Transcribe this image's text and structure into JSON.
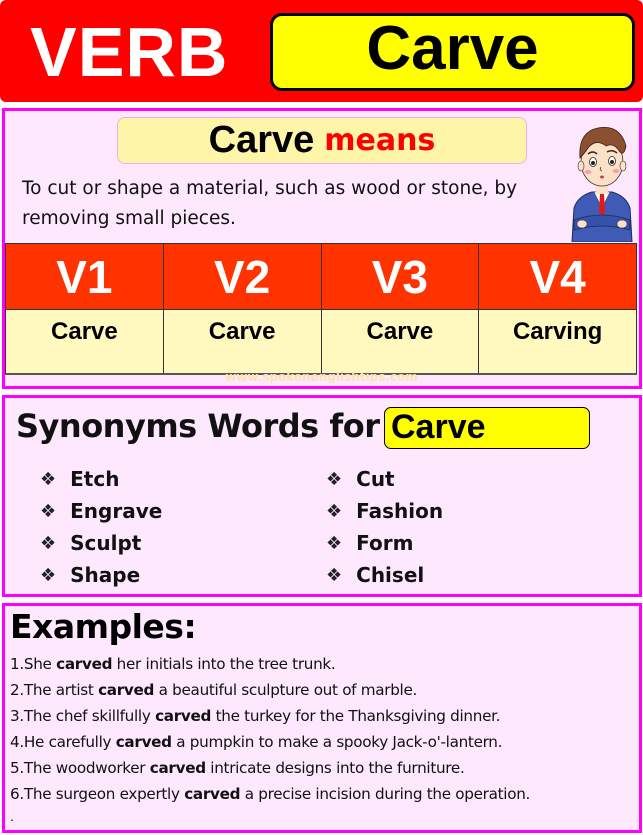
{
  "header": {
    "label": "VERB",
    "word": "Carve"
  },
  "meaning": {
    "word": "Carve",
    "suffix": "means",
    "definition": "To cut or shape a material, such as wood or stone, by removing small pieces.",
    "illustration": "confused-businessman-cartoon"
  },
  "forms": {
    "headers": [
      "V1",
      "V2",
      "V3",
      "V4"
    ],
    "values": [
      "Carve",
      "Carve",
      "Carve",
      "Carving"
    ]
  },
  "watermark": "www.spokenenglishtips.com",
  "synonyms": {
    "title": "Synonyms Words for",
    "word": "Carve",
    "bullet": "❖",
    "left": [
      "Etch",
      "Engrave",
      "Sculpt",
      "Shape"
    ],
    "right": [
      "Cut",
      "Fashion",
      "Form",
      "Chisel"
    ]
  },
  "examples": {
    "title": "Examples:",
    "items": [
      {
        "num": "1.",
        "before": "She ",
        "bold": "carved",
        "after": " her initials into the tree trunk."
      },
      {
        "num": "2.",
        "before": "The artist ",
        "bold": "carved",
        "after": " a beautiful sculpture out of marble."
      },
      {
        "num": "3.",
        "before": "The chef skillfully ",
        "bold": "carved",
        "after": " the turkey for the Thanksgiving dinner."
      },
      {
        "num": "4.",
        "before": "He carefully ",
        "bold": "carved",
        "after": " a pumpkin to make a spooky Jack-o'-lantern."
      },
      {
        "num": "5.",
        "before": "The woodworker ",
        "bold": "carved",
        "after": " intricate designs into the furniture."
      },
      {
        "num": "6.",
        "before": "The surgeon expertly ",
        "bold": "carved",
        "after": " a precise incision during the operation."
      }
    ],
    "trailing": "."
  },
  "colors": {
    "header_red": "#ff0000",
    "highlight_yellow": "#ffff00",
    "panel_border": "#ff00ff",
    "panel_bg": "#fde8fd",
    "table_header": "#ff3300",
    "table_cell": "#fff9c0"
  }
}
